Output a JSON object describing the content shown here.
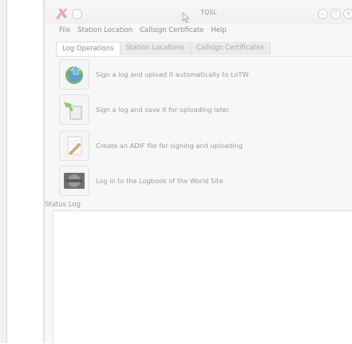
{
  "window": {
    "title": "TQSL"
  },
  "menu": [
    "File",
    "Station Location",
    "Callsign Certificate",
    "Help"
  ],
  "tabs": [
    "Log Operations",
    "Station Locations",
    "Callsign Certificates"
  ],
  "operations": [
    {
      "label": "Sign a log and upload it automatically to LoTW",
      "icon": "globe-upload-icon"
    },
    {
      "label": "Sign a log and save it for uploading later",
      "icon": "save-log-icon"
    },
    {
      "label": "Create an ADIF file for signing and uploading",
      "icon": "edit-document-icon"
    },
    {
      "label": "Log in to the Logbook of the World Site",
      "icon": "logbook-site-icon"
    }
  ],
  "status_log": {
    "label": "Status Log",
    "content": ""
  },
  "colors": {
    "background": "#f7f7f7",
    "tab_active": "#ffffff",
    "tab_inactive": "#ebebeb",
    "text": "#8e8e8e"
  }
}
